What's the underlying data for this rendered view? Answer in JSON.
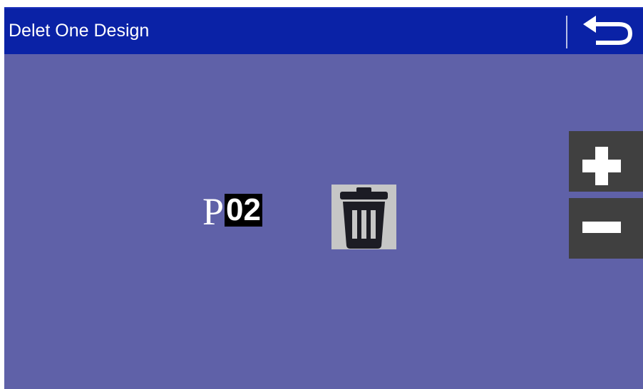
{
  "header": {
    "title": "Delet One Design",
    "back_icon": "return-arrow-icon"
  },
  "design": {
    "prefix": "P",
    "number": "02"
  },
  "actions": {
    "delete_icon": "trash-can-icon",
    "increase_icon": "plus-icon",
    "decrease_icon": "minus-icon"
  },
  "colors": {
    "header_bg": "#0a22a6",
    "main_bg": "#5f61a8",
    "button_bg": "#404040",
    "delete_bg": "#c6c6c6"
  }
}
